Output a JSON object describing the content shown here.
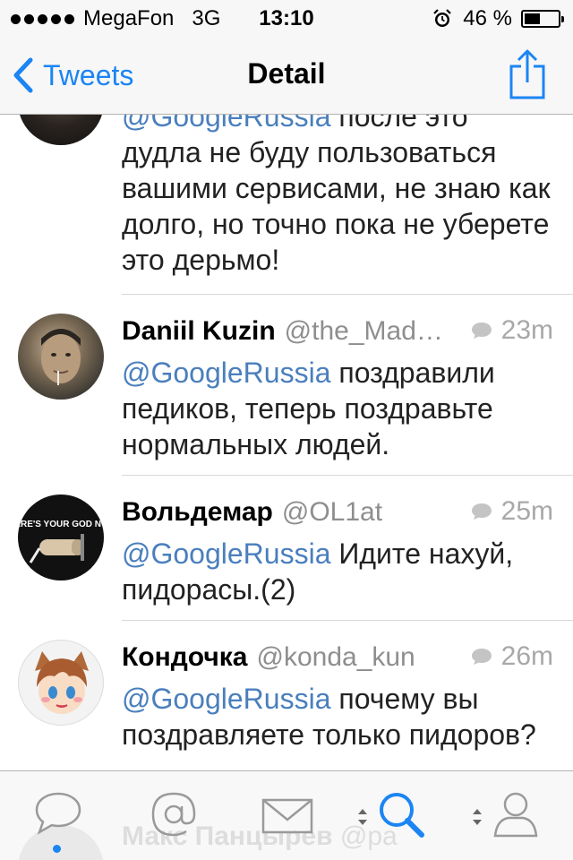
{
  "status_bar": {
    "carrier": "MegaFon",
    "network": "3G",
    "time": "13:10",
    "battery": "46 %",
    "battery_level": 0.46
  },
  "nav": {
    "back_label": "Tweets",
    "title": "Detail"
  },
  "tweets": [
    {
      "mention": "@GoogleRussia",
      "text": " после это дудла не буду пользоваться вашими сервисами, не знаю как долго, но точно пока не уберете это дерьмо!"
    },
    {
      "name": "Daniil Kuzin",
      "handle": "@the_Mad…",
      "time": "23m",
      "mention": "@GoogleRussia",
      "text": " поздравили педиков, теперь поздравьте нормальных людей."
    },
    {
      "name": "Вольдемар",
      "handle": "@OL1at",
      "time": "25m",
      "mention": "@GoogleRussia",
      "text": " Идите нахуй, пидорасы.(2)",
      "avatar_text": "WHERE'S YOUR GOD NOW?"
    },
    {
      "name": "Кондочка",
      "handle": "@konda_kun",
      "time": "26m",
      "mention": "@GoogleRussia",
      "text": " почему вы поздравляете только пидоров?"
    }
  ],
  "peek": {
    "name": "Макс Панцырев",
    "handle": "@pa"
  },
  "tab_bar": {
    "tabs": [
      "home",
      "mentions",
      "messages",
      "search",
      "profile"
    ],
    "active": "search",
    "accent": "#1b85f3"
  },
  "colors": {
    "accent": "#1b85f3",
    "mention": "#4a7fbd"
  }
}
